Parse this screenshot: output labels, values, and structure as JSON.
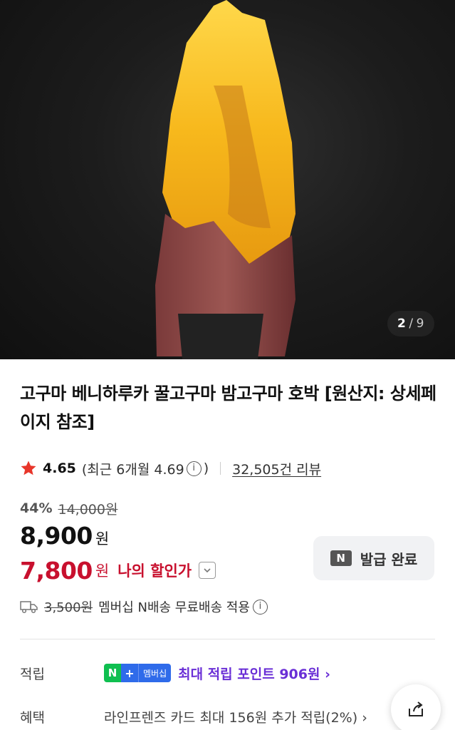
{
  "gallery": {
    "current": "2",
    "separator": "/",
    "total": "9"
  },
  "product": {
    "title": "고구마 베니하루카 꿀고구마 밤고구마 호박 [원산지: 상세페이지 참조]"
  },
  "rating": {
    "score": "4.65",
    "recent": "(최근 6개월 4.69",
    "recent_close": ")",
    "info_icon": "i",
    "reviews": "32,505건 리뷰"
  },
  "price": {
    "discount_percent": "44%",
    "original": "14,000원",
    "sale": "8,900",
    "won": "원",
    "my_price": "7,800",
    "my_won": "원",
    "my_label": "나의 할인가"
  },
  "coupon": {
    "badge": "N",
    "label": "발급 완료"
  },
  "shipping": {
    "original": "3,500원",
    "text": "멤버십 N배송 무료배송 적용",
    "info_icon": "i"
  },
  "points": {
    "key": "적립",
    "badge_n": "N",
    "badge_plus": "+",
    "badge_text": "멤버십",
    "text": "최대 적립 포인트 906원 ›"
  },
  "benefit": {
    "key": "혜택",
    "text": "라인프렌즈 카드 최대 156원 추가 적립(2%) ›"
  },
  "colors": {
    "accent_red": "#c8102e",
    "point_purple": "#6a2fd6",
    "naver_green": "#0fbf50",
    "naver_blue": "#2f6bea"
  },
  "icons": [
    "star-icon",
    "info-icon",
    "chevron-down-icon",
    "truck-icon",
    "share-icon"
  ]
}
